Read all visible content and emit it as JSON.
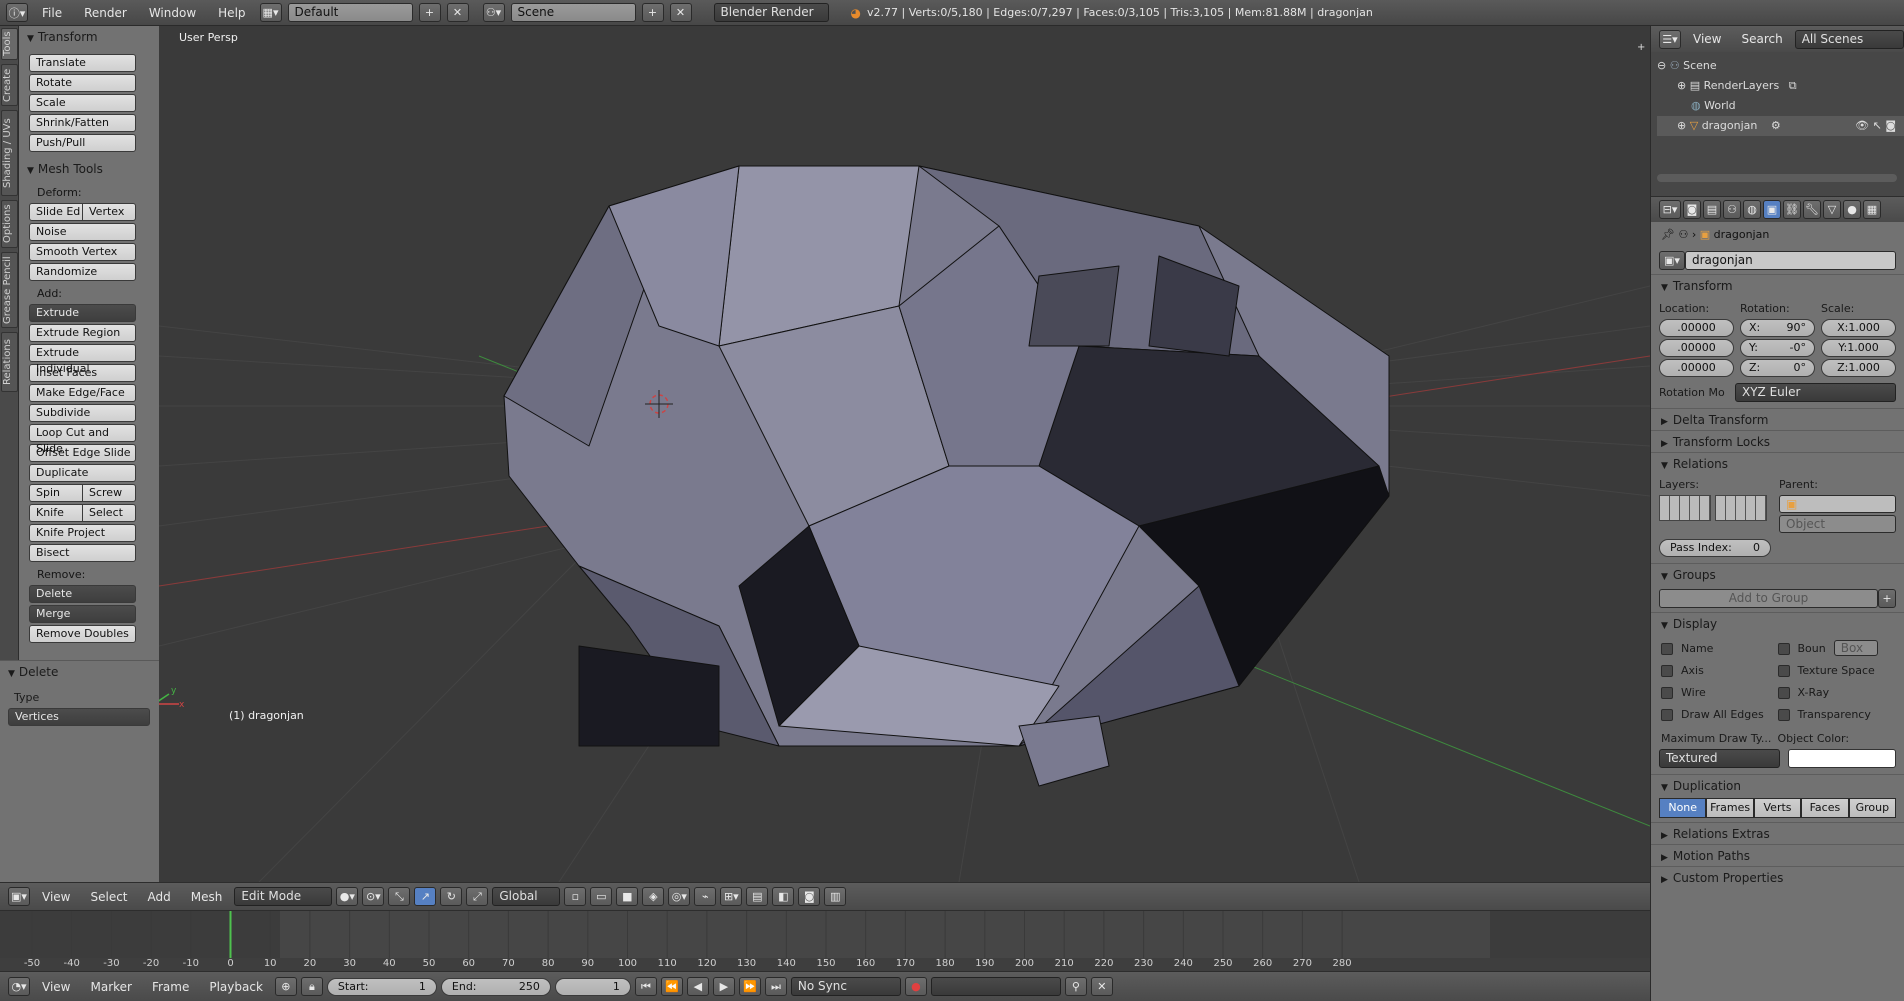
{
  "topbar": {
    "menus": [
      "File",
      "Render",
      "Window",
      "Help"
    ],
    "screen_layout": "Default",
    "scene": "Scene",
    "render_engine": "Blender Render",
    "stats": "v2.77 | Verts:0/5,180 | Edges:0/7,297 | Faces:0/3,105 | Tris:3,105 | Mem:81.88M | dragonjan"
  },
  "tabs": [
    "Tools",
    "Create",
    "Shading / UVs",
    "Options",
    "Grease Pencil",
    "Relations"
  ],
  "toolshelf": {
    "transform_title": "Transform",
    "transform_buttons": [
      "Translate",
      "Rotate",
      "Scale",
      "Shrink/Fatten",
      "Push/Pull"
    ],
    "mesh_tools_title": "Mesh Tools",
    "deform_label": "Deform:",
    "deform_pair": [
      "Slide Ed",
      "Vertex"
    ],
    "deform_buttons": [
      "Noise",
      "Smooth Vertex",
      "Randomize"
    ],
    "add_label": "Add:",
    "extrude": "Extrude",
    "add_buttons": [
      "Extrude Region",
      "Extrude Individual",
      "Inset Faces",
      "Make Edge/Face",
      "Subdivide",
      "Loop Cut and Slide",
      "Offset Edge Slide",
      "Duplicate"
    ],
    "spin_pair": [
      "Spin",
      "Screw"
    ],
    "knife_pair": [
      "Knife",
      "Select"
    ],
    "more_buttons": [
      "Knife Project",
      "Bisect"
    ],
    "remove_label": "Remove:",
    "delete_btn": "Delete",
    "merge_btn": "Merge",
    "remove_doubles": "Remove Doubles",
    "operator_title": "Delete",
    "type_label": "Type",
    "type_value": "Vertices"
  },
  "viewport": {
    "view_label": "User Persp",
    "object_label": "(1) dragonjan",
    "axis_labels": [
      "z",
      "y",
      "x"
    ]
  },
  "view_header": {
    "menus": [
      "View",
      "Select",
      "Add",
      "Mesh"
    ],
    "mode": "Edit Mode",
    "orientation": "Global"
  },
  "timeline": {
    "ticks": [
      "-50",
      "-40",
      "-30",
      "-20",
      "-10",
      "0",
      "10",
      "20",
      "30",
      "40",
      "50",
      "60",
      "70",
      "80",
      "90",
      "100",
      "110",
      "120",
      "130",
      "140",
      "150",
      "160",
      "170",
      "180",
      "190",
      "200",
      "210",
      "220",
      "230",
      "240",
      "250",
      "260",
      "270",
      "280"
    ],
    "current_frame_value": 0
  },
  "timeline_header": {
    "menus": [
      "View",
      "Marker",
      "Frame",
      "Playback"
    ],
    "start": "Start:",
    "start_value": "1",
    "end": "End:",
    "end_value": "250",
    "current": "1",
    "sync": "No Sync"
  },
  "outliner": {
    "menus": [
      "View",
      "Search"
    ],
    "filter": "All Scenes",
    "items": [
      "Scene",
      "RenderLayers",
      "World",
      "dragonjan"
    ]
  },
  "properties": {
    "breadcrumb": "dragonjan",
    "object_name": "dragonjan",
    "transform_title": "Transform",
    "location_label": "Location:",
    "rotation_label": "Rotation:",
    "scale_label": "Scale:",
    "location": [
      ".00000",
      ".00000",
      ".00000"
    ],
    "rotation": [
      "X:",
      "90°",
      "Y:",
      "-0°",
      "Z:",
      "0°"
    ],
    "scale": [
      "X:1.000",
      "Y:1.000",
      "Z:1.000"
    ],
    "rotation_mode_label": "Rotation Mo",
    "rotation_mode": "XYZ Euler",
    "collapsed_1": [
      "Delta Transform",
      "Transform Locks"
    ],
    "relations_title": "Relations",
    "layers_label": "Layers:",
    "parent_label": "Parent:",
    "parent_type": "Object",
    "pass_index_label": "Pass Index:",
    "pass_index": "0",
    "groups_title": "Groups",
    "add_to_group": "Add to Group",
    "display_title": "Display",
    "display_left": [
      "Name",
      "Axis",
      "Wire",
      "Draw All Edges"
    ],
    "display_right": [
      "Boun",
      "Texture Space",
      "X-Ray",
      "Transparency"
    ],
    "bounds_type": "Box",
    "max_draw_label": "Maximum Draw Ty...",
    "object_color_label": "Object Color:",
    "max_draw_value": "Textured",
    "duplication_title": "Duplication",
    "duplication_options": [
      "None",
      "Frames",
      "Verts",
      "Faces",
      "Group"
    ],
    "collapsed_2": [
      "Relations Extras",
      "Motion Paths",
      "Custom Properties"
    ]
  },
  "colors": {
    "accent": "#5680c2",
    "current_frame": "#4ec24e",
    "mesh": "#7a7a8e"
  }
}
